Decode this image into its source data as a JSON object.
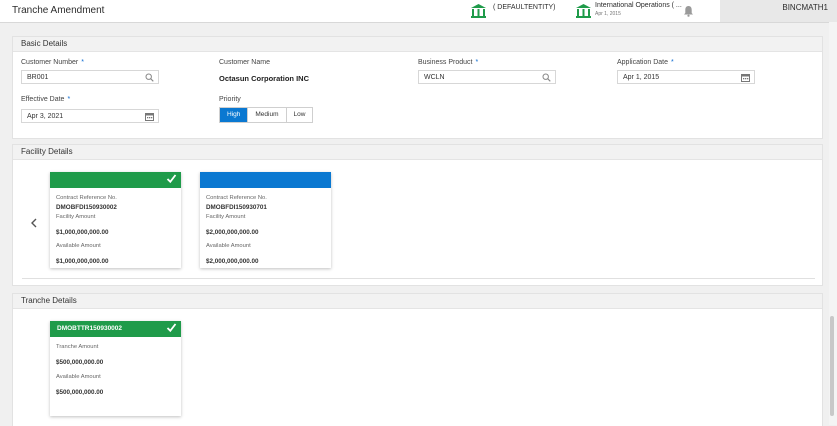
{
  "header": {
    "title": "Tranche Amendment",
    "entity": "( DEFAULTENTITY)",
    "branch_name": "International Operations ( ...",
    "branch_date": "Apr 1, 2015",
    "user": "BINCMATH1",
    "icons": [
      "bank-icon",
      "bank-icon",
      "bell-icon"
    ]
  },
  "basic_details": {
    "title": "Basic Details",
    "customer_number": {
      "label": "Customer Number",
      "value": "BR001",
      "icon": "search-icon"
    },
    "customer_name": {
      "label": "Customer Name",
      "value": "Octasun Corporation INC"
    },
    "business_product": {
      "label": "Business Product",
      "value": "WCLN",
      "icon": "search-icon"
    },
    "application_date": {
      "label": "Application Date",
      "value": "Apr 1, 2015",
      "icon": "calendar-icon"
    },
    "effective_date": {
      "label": "Effective Date",
      "value": "Apr 3, 2021",
      "icon": "calendar-icon"
    },
    "priority": {
      "label": "Priority",
      "options": [
        "High",
        "Medium",
        "Low"
      ],
      "selected": "High"
    },
    "required_mark": "*"
  },
  "facility_details": {
    "title": "Facility Details",
    "cards": [
      {
        "status": "selected",
        "ref_label": "Contract Reference No.",
        "ref": "DMOBFDI150930002",
        "facility_label": "Facility Amount",
        "facility_amount": "$1,000,000,000.00",
        "available_label": "Available Amount",
        "available_amount": "$1,000,000,000.00"
      },
      {
        "status": "unselected",
        "ref_label": "Contract Reference No.",
        "ref": "DMOBFDI150930701",
        "facility_label": "Facility Amount",
        "facility_amount": "$2,000,000,000.00",
        "available_label": "Available Amount",
        "available_amount": "$2,000,000,000.00"
      }
    ]
  },
  "tranche_details": {
    "title": "Tranche Details",
    "cards": [
      {
        "ref": "DMOBTTR150930002",
        "tranche_label": "Tranche Amount",
        "tranche_amount": "$500,000,000.00",
        "available_label": "Available Amount",
        "available_amount": "$500,000,000.00"
      }
    ]
  },
  "colors": {
    "accent_blue": "#0a78d1",
    "selected_green": "#1f9b4a",
    "required_blue": "#0a6ad1"
  }
}
